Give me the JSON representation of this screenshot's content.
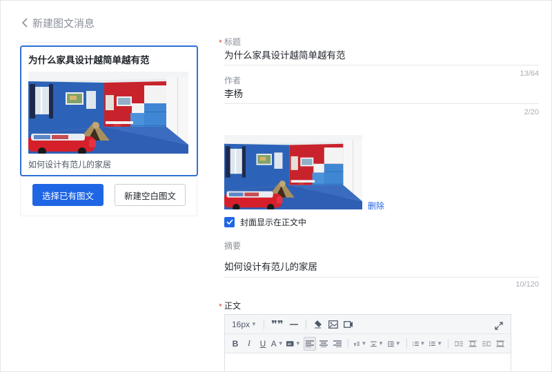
{
  "header": {
    "back_label": "新建图文消息"
  },
  "article_card": {
    "title": "为什么家具设计越简单越有范",
    "summary": "如何设计有范儿的家居"
  },
  "buttons": {
    "select_existing": "选择已有图文",
    "new_blank": "新建空白图文"
  },
  "form": {
    "title_label": "标题",
    "title_value": "为什么家具设计越简单越有范",
    "title_counter": "13/64",
    "author_label": "作者",
    "author_value": "李杨",
    "author_counter": "2/20",
    "delete_label": "删除",
    "cover_checkbox_label": "封面显示在正文中",
    "cover_checked": true,
    "summary_label": "摘要",
    "summary_value": "如何设计有范儿的家居",
    "summary_counter": "10/120",
    "body_label": "正文"
  },
  "editor": {
    "font_size": "16px",
    "toolbar_row1_icons": [
      "quote-icon",
      "divider-line-icon",
      "clear-format-icon",
      "image-icon",
      "video-icon"
    ],
    "toolbar_row2_icons": [
      "bold-icon",
      "italic-icon",
      "underline-icon",
      "font-color-icon",
      "background-color-icon",
      "align-left-icon",
      "align-center-icon",
      "align-right-icon",
      "line-height-icon",
      "paragraph-spacing-icon",
      "indent-icon",
      "ordered-list-icon",
      "unordered-list-icon",
      "float-left-icon",
      "float-none-icon",
      "float-right-icon",
      "float-center-icon"
    ]
  },
  "colors": {
    "primary": "#1f66e5",
    "required": "#e03e3e",
    "wall_red": "#c8232c",
    "wall_blue": "#2c63b8"
  }
}
